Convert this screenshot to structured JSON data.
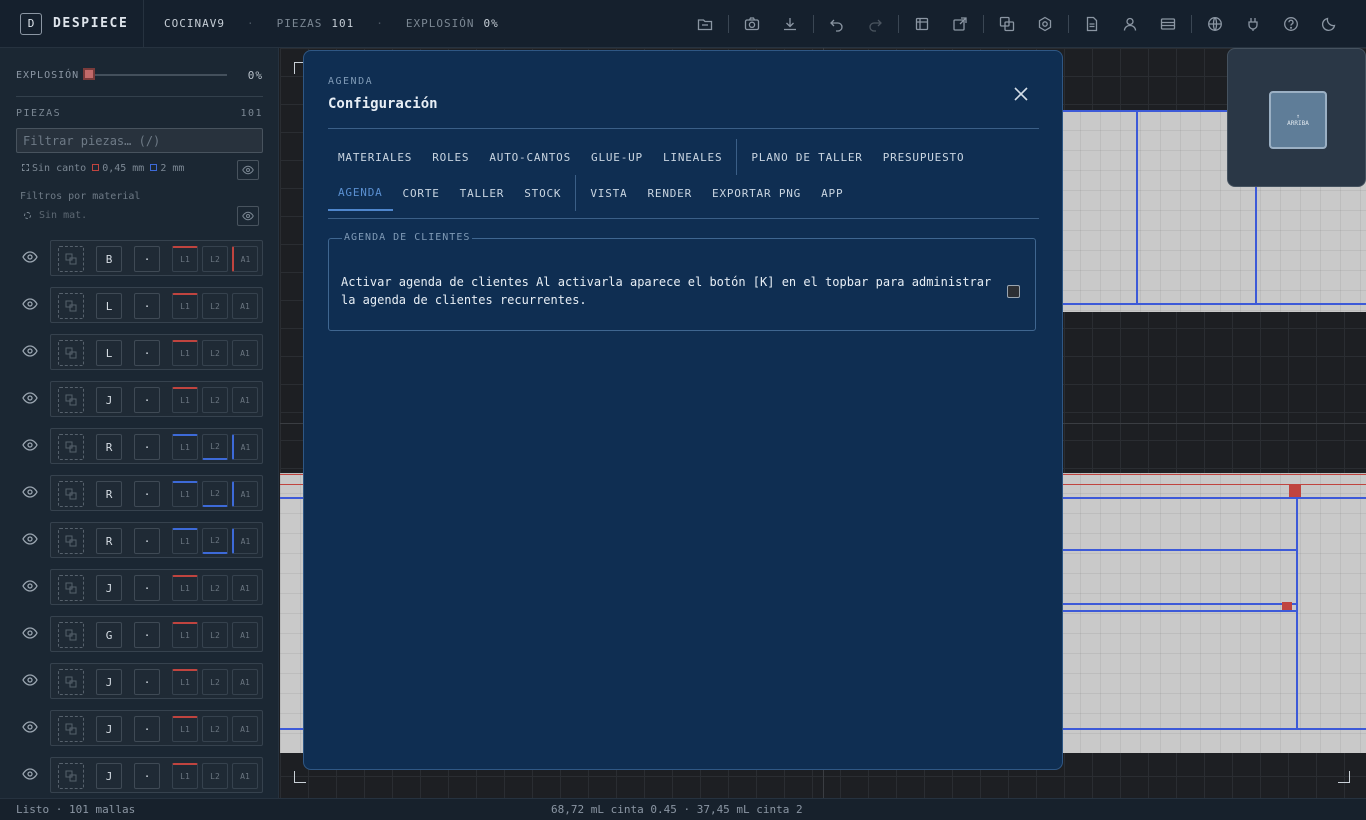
{
  "topbar": {
    "brand_mark": "D",
    "brand_name": "DESPIECE",
    "project_name": "COCINAV9",
    "dot": "·",
    "piezas_label": "PIEZAS",
    "piezas_value": "101",
    "explosion_label": "EXPLOSIÓN",
    "explosion_value": "0%",
    "icons": [
      "folder-open-icon",
      "camera-icon",
      "download-icon",
      "undo-icon",
      "redo-icon",
      "cut-list-icon",
      "edit-export-icon",
      "layers-icon",
      "settings-hex-icon",
      "document-icon",
      "user-icon",
      "card-icon",
      "globe-icon",
      "plugin-icon",
      "help-icon",
      "moon-icon"
    ]
  },
  "sidebar": {
    "explosion_label": "EXPLOSIÓN",
    "explosion_value": "0%",
    "explosion_level": 0,
    "piezas_label": "PIEZAS",
    "piezas_count": "101",
    "filter_placeholder": "Filtrar piezas… (/)",
    "legend": {
      "sin_canto": "Sin canto",
      "red": "0,45 mm",
      "blue": "2 mm"
    },
    "materials_header": "Filtros por material",
    "sin_mat": "Sin mat.",
    "rows": [
      {
        "letter": "B",
        "dot": "·",
        "e1": "L1",
        "e2": "L2",
        "e3": "A1"
      },
      {
        "letter": "L",
        "dot": "·",
        "e1": "L1",
        "e2": "L2",
        "e3": "A1"
      },
      {
        "letter": "L",
        "dot": "·",
        "e1": "L1",
        "e2": "L2",
        "e3": "A1"
      },
      {
        "letter": "J",
        "dot": "·",
        "e1": "L1",
        "e2": "L2",
        "e3": "A1"
      },
      {
        "letter": "R",
        "dot": "·",
        "e1": "L1",
        "e2": "L2",
        "e3": "A1"
      },
      {
        "letter": "R",
        "dot": "·",
        "e1": "L1",
        "e2": "L2",
        "e3": "A1"
      },
      {
        "letter": "R",
        "dot": "·",
        "e1": "L1",
        "e2": "L2",
        "e3": "A1"
      },
      {
        "letter": "J",
        "dot": "·",
        "e1": "L1",
        "e2": "L2",
        "e3": "A1"
      },
      {
        "letter": "G",
        "dot": "·",
        "e1": "L1",
        "e2": "L2",
        "e3": "A1"
      },
      {
        "letter": "J",
        "dot": "·",
        "e1": "L1",
        "e2": "L2",
        "e3": "A1"
      },
      {
        "letter": "J",
        "dot": "·",
        "e1": "L1",
        "e2": "L2",
        "e3": "A1"
      },
      {
        "letter": "J",
        "dot": "·",
        "e1": "L1",
        "e2": "L2",
        "e3": "A1"
      }
    ]
  },
  "minimap": {
    "label": "ARRIBA",
    "arrow": "↑"
  },
  "status": {
    "left": "Listo · 101 mallas",
    "center": "68,72 mL cinta 0.45 · 37,45 mL cinta 2"
  },
  "modal": {
    "kicker": "AGENDA",
    "title": "Configuración",
    "tabs_row1": [
      "MATERIALES",
      "ROLES",
      "AUTO-CANTOS",
      "GLUE-UP",
      "LINEALES",
      "PLANO DE TALLER",
      "PRESUPUESTO"
    ],
    "tabs_row2": [
      "AGENDA",
      "CORTE",
      "TALLER",
      "STOCK",
      "VISTA",
      "RENDER",
      "EXPORTAR PNG",
      "APP"
    ],
    "active_tab": "AGENDA",
    "section_title": "AGENDA DE CLIENTES",
    "setting_text": "Activar agenda de clientes Al activarla aparece el botón [K] en el topbar para administrar la agenda de clientes recurrentes.",
    "setting_checked": false
  },
  "colors": {
    "accent": "#4f86cc",
    "modal_bg": "#0f2e52",
    "edge_red": "#c0443f",
    "edge_blue": "#3d6ad8"
  }
}
